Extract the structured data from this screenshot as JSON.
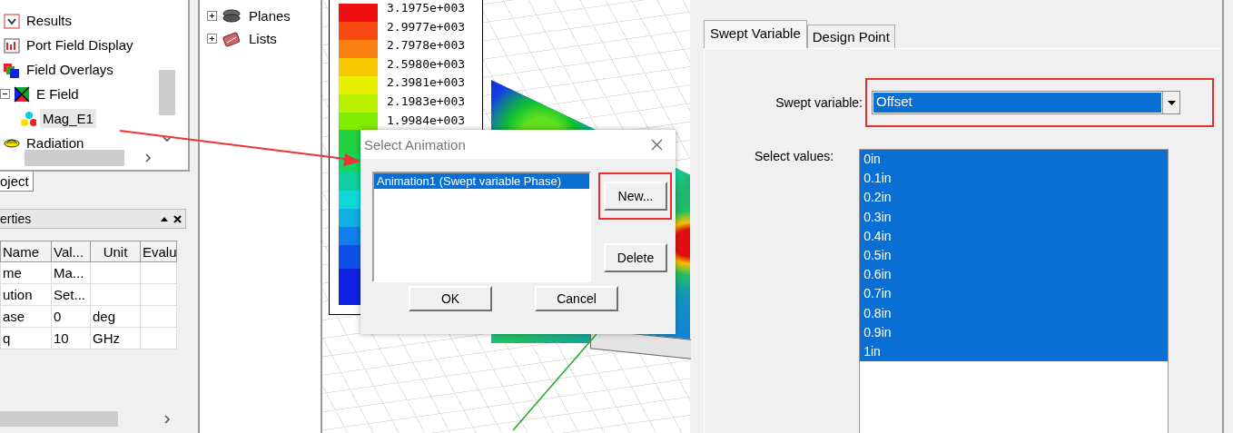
{
  "project_tree": {
    "items": [
      {
        "label": "Results",
        "selected": false
      },
      {
        "label": "Port Field Display",
        "selected": false
      },
      {
        "label": "Field Overlays",
        "selected": false,
        "children": [
          {
            "label": "E Field",
            "selected": false,
            "expanded": true,
            "children": [
              {
                "label": "Mag_E1",
                "selected": true
              }
            ]
          }
        ]
      },
      {
        "label": "Radiation",
        "selected": false
      }
    ]
  },
  "project_tabs": [
    {
      "label": "oject",
      "selected": true
    }
  ],
  "properties": {
    "title": "erties",
    "columns": [
      "Name",
      "Val...",
      "Unit",
      "Evalu"
    ],
    "rows": [
      {
        "name": "me",
        "value": "Ma..."
      },
      {
        "name": "ution",
        "value": "Set..."
      },
      {
        "name": "ase",
        "value": "0",
        "unit": "deg"
      },
      {
        "name": "q",
        "value": "10",
        "unit": "GHz"
      }
    ]
  },
  "model_tree": {
    "items": [
      {
        "label": "Planes",
        "expanded": false
      },
      {
        "label": "Lists",
        "expanded": false
      }
    ]
  },
  "legend": {
    "values": [
      "3.1975e+003",
      "2.9977e+003",
      "2.7978e+003",
      "2.5980e+003",
      "2.3981e+003",
      "2.1983e+003",
      "1.9984e+003"
    ]
  },
  "dialog": {
    "title": "Select Animation",
    "items": [
      {
        "label": "Animation1 (Swept variable Phase)",
        "selected": true
      }
    ],
    "side_buttons": [
      {
        "label": "New...",
        "highlighted": true
      },
      {
        "label": "Delete",
        "highlighted": false
      }
    ],
    "buttons": [
      "OK",
      "Cancel"
    ]
  },
  "setup": {
    "tabs": [
      {
        "label": "Swept Variable",
        "selected": true
      },
      {
        "label": "Design Point",
        "selected": false
      }
    ],
    "swept_variable": {
      "label": "Swept variable:",
      "value": "Offset",
      "highlighted": true
    },
    "select_values": {
      "label": "Select values:",
      "items": [
        {
          "label": "0in",
          "selected": true
        },
        {
          "label": "0.1in",
          "selected": true
        },
        {
          "label": "0.2in",
          "selected": true
        },
        {
          "label": "0.3in",
          "selected": true
        },
        {
          "label": "0.4in",
          "selected": true
        },
        {
          "label": "0.5in",
          "selected": true
        },
        {
          "label": "0.6in",
          "selected": true
        },
        {
          "label": "0.7in",
          "selected": true
        },
        {
          "label": "0.8in",
          "selected": true
        },
        {
          "label": "0.9in",
          "selected": true
        },
        {
          "label": "1in",
          "selected": true
        }
      ]
    }
  }
}
